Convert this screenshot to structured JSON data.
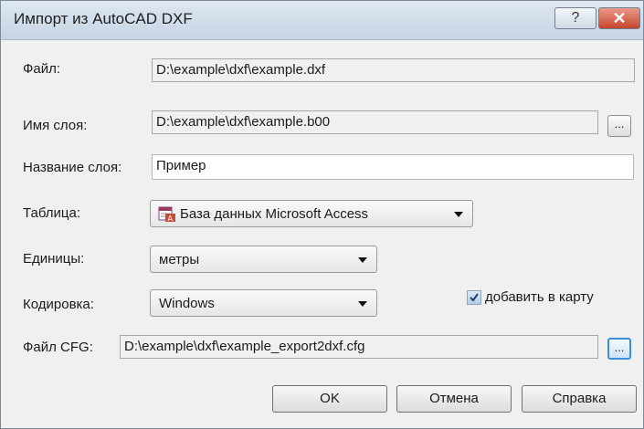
{
  "window": {
    "title": "Импорт из AutoCAD DXF",
    "help_label": "?",
    "close_label": "✕"
  },
  "file": {
    "label": "Файл:",
    "value": "D:\\example\\dxf\\example.dxf"
  },
  "layer_name": {
    "label": "Имя слоя:",
    "value": "D:\\example\\dxf\\example.b00",
    "browse_label": "..."
  },
  "layer_title": {
    "label": "Название слоя:",
    "value": "Пример"
  },
  "table": {
    "label": "Таблица:",
    "value": "База данных Microsoft Access",
    "icon": "access-database-icon"
  },
  "units": {
    "label": "Единицы:",
    "value": "метры"
  },
  "encoding": {
    "label": "Кодировка:",
    "value": "Windows"
  },
  "add_to_map": {
    "label": "добавить в карту",
    "checked": true
  },
  "cfg_file": {
    "label": "Файл CFG:",
    "value": "D:\\example\\dxf\\example_export2dxf.cfg",
    "browse_label": "..."
  },
  "buttons": {
    "ok": "OK",
    "cancel": "Отмена",
    "help": "Справка"
  }
}
